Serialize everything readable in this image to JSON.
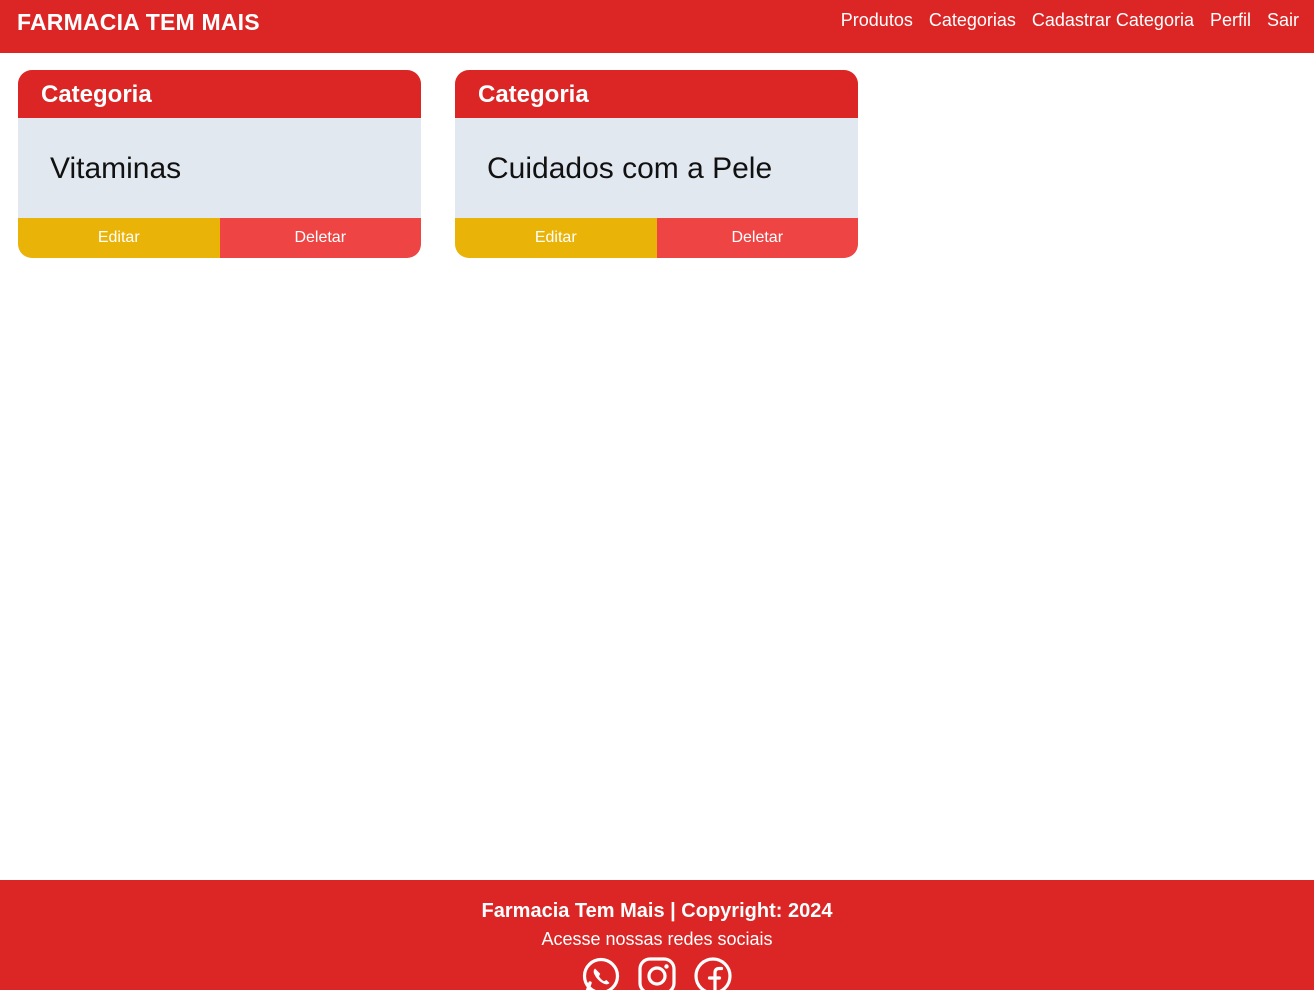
{
  "header": {
    "brand": "FARMACIA TEM MAIS",
    "nav": [
      {
        "label": "Produtos"
      },
      {
        "label": "Categorias"
      },
      {
        "label": "Cadastrar Categoria"
      },
      {
        "label": "Perfil"
      },
      {
        "label": "Sair"
      }
    ]
  },
  "cards": [
    {
      "header": "Categoria",
      "name": "Vitaminas",
      "edit_label": "Editar",
      "delete_label": "Deletar"
    },
    {
      "header": "Categoria",
      "name": "Cuidados com a Pele",
      "edit_label": "Editar",
      "delete_label": "Deletar"
    }
  ],
  "footer": {
    "title": "Farmacia Tem Mais | Copyright: 2024",
    "subtitle": "Acesse nossas redes sociais",
    "social": [
      "whatsapp-icon",
      "instagram-icon",
      "facebook-icon"
    ]
  },
  "colors": {
    "brand_red": "#dc2626",
    "card_body": "#e2e8f0",
    "edit_button": "#eab308",
    "delete_button": "#ef4444"
  }
}
